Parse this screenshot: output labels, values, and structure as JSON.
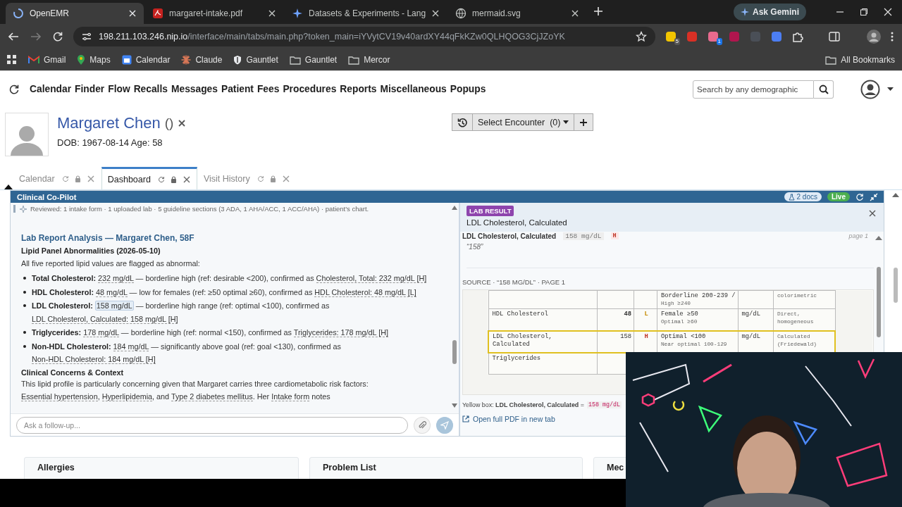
{
  "browser": {
    "tabs": [
      {
        "title": "OpenEMR",
        "kind": "openemr",
        "selected": true
      },
      {
        "title": "margaret-intake.pdf",
        "kind": "pdf",
        "selected": false
      },
      {
        "title": "Datasets & Experiments - Lang",
        "kind": "datasets",
        "selected": false
      },
      {
        "title": "mermaid.svg",
        "kind": "globe",
        "selected": false
      }
    ],
    "gemini": "Ask Gemini",
    "address": {
      "host": "198.211.103.246.nip.io",
      "path": "/interface/main/tabs/main.php?token_main=iYVytCV19v40ardXY44qFkKZw0QLHQOG3CjJZoYK"
    },
    "extensions": [
      {
        "color": "#f2c500",
        "badge": "5"
      },
      {
        "color": "#d93025"
      },
      {
        "color": "#e86a8e",
        "badge": "1"
      },
      {
        "color": "#b0164e"
      },
      {
        "color": "#4a4f57"
      },
      {
        "color": "#4c7ef3"
      }
    ],
    "bookmarks": [
      {
        "label": "Gmail",
        "kind": "gmail"
      },
      {
        "label": "Maps",
        "kind": "maps"
      },
      {
        "label": "Calendar",
        "kind": "calendar"
      },
      {
        "label": "Claude",
        "kind": "claude"
      },
      {
        "label": "Gauntlet",
        "kind": "gauntlet"
      },
      {
        "label": "Gauntlet",
        "kind": "folder"
      },
      {
        "label": "Mercor",
        "kind": "folder"
      }
    ],
    "all_bookmarks": "All Bookmarks"
  },
  "emr": {
    "nav": [
      "Calendar",
      "Finder",
      "Flow",
      "Recalls",
      "Messages",
      "Patient",
      "Fees",
      "Procedures",
      "Reports",
      "Miscellaneous",
      "Popups"
    ],
    "search_placeholder": "Search by any demographic",
    "patient": {
      "name": "Margaret Chen",
      "pronouns": "()",
      "dob": "DOB: 1967-08-14 Age: 58"
    },
    "encounter": {
      "label": "Select Encounter",
      "count": "(0)"
    },
    "tabs": [
      {
        "label": "Calendar",
        "selected": false
      },
      {
        "label": "Dashboard",
        "selected": true
      },
      {
        "label": "Visit History",
        "selected": false
      }
    ]
  },
  "copilot": {
    "title": "Clinical Co-Pilot",
    "docs": "2 docs",
    "live": "Live",
    "reviewed": "Reviewed: 1 intake form · 1 uploaded lab · 5 guideline sections (3 ADA, 1 AHA/ACC, 1 ACC/AHA) · patient's chart.",
    "heading": "Lab Report Analysis — Margaret Chen, 58F",
    "subheading": "Lipid Panel Abnormalities (2026-05-10)",
    "intro": "All five reported lipid values are flagged as abnormal:",
    "findings": [
      {
        "label": "Total Cholesterol:",
        "value": "232 mg/dL",
        "text": "— borderline high (ref: desirable <200), confirmed as",
        "citation": "Cholesterol, Total: 232 mg/dL [H]",
        "selected": false
      },
      {
        "label": "HDL Cholesterol:",
        "value": "48 mg/dL",
        "text": "— low for females (ref: ≥50 optimal ≥60), confirmed as",
        "citation": "HDL Cholesterol: 48 mg/dL [L]",
        "selected": false
      },
      {
        "label": "LDL Cholesterol:",
        "value": "158 mg/dL",
        "text": "— borderline high range (ref: optimal <100), confirmed as",
        "citation": "LDL Cholesterol, Calculated: 158 mg/dL [H]",
        "selected": true
      },
      {
        "label": "Triglycerides:",
        "value": "178 mg/dL",
        "text": "— borderline high (ref: normal <150), confirmed as",
        "citation": "Triglycerides: 178 mg/dL [H]",
        "selected": false
      },
      {
        "label": "Non-HDL Cholesterol:",
        "value": "184 mg/dL",
        "text": "— significantly above goal (ref: goal <130), confirmed as",
        "citation": "Non-HDL Cholesterol: 184 mg/dL [H]",
        "selected": false
      }
    ],
    "concerns_heading": "Clinical Concerns & Context",
    "paragraph": [
      {
        "kind": "text",
        "text": "This lipid profile is particularly concerning given that Margaret carries three cardiometabolic risk factors: "
      },
      {
        "kind": "cite",
        "text": "Essential hypertension"
      },
      {
        "kind": "text",
        "text": ", "
      },
      {
        "kind": "cite",
        "text": "Hyperlipidemia"
      },
      {
        "kind": "text",
        "text": ", and "
      },
      {
        "kind": "cite",
        "text": "Type 2 diabetes mellitus"
      },
      {
        "kind": "text",
        "text": ". Her "
      },
      {
        "kind": "cite",
        "text": "Intake form"
      },
      {
        "kind": "text",
        "text": " notes"
      }
    ],
    "input_placeholder": "Ask a follow-up..."
  },
  "lab": {
    "badge": "LAB RESULT",
    "title": "LDL Cholesterol, Calculated",
    "snippet": {
      "name": "LDL Cholesterol, Calculated",
      "value": "158 mg/dL",
      "flag": "H",
      "page": "page 1"
    },
    "quote": "“158”",
    "source": "SOURCE · “158 MG/DL” · PAGE 1",
    "document": [
      {
        "range": [
          "Borderline 200-239 /",
          "High ≥240"
        ],
        "method": [
          "colorimetric"
        ],
        "highlighted": false
      },
      {
        "test": [
          "HDL Cholesterol"
        ],
        "result": "48",
        "flag": "L",
        "range": [
          "Female ≥50",
          "Optimal ≥60"
        ],
        "unit": "mg/dL",
        "method": [
          "Direct,",
          "homogeneous"
        ],
        "highlighted": false
      },
      {
        "test": [
          "LDL Cholesterol,",
          "Calculated"
        ],
        "result": "158",
        "flag": "H",
        "range": [
          "Optimal <100",
          "Near optimal 100-129"
        ],
        "unit": "mg/dL",
        "method": [
          "Calculated",
          "(Friedewald)"
        ],
        "highlighted": true
      },
      {
        "test": [
          "Triglycerides"
        ],
        "highlighted": false
      }
    ],
    "yellow_box": {
      "text": "Yellow box: **LDL Cholesterol, Calculated** =",
      "value": "158 mg/dL"
    },
    "open_pdf": "Open full PDF in new tab"
  },
  "cards": [
    {
      "title": "Allergies"
    },
    {
      "title": "Problem List"
    },
    {
      "title": "Mec"
    }
  ]
}
